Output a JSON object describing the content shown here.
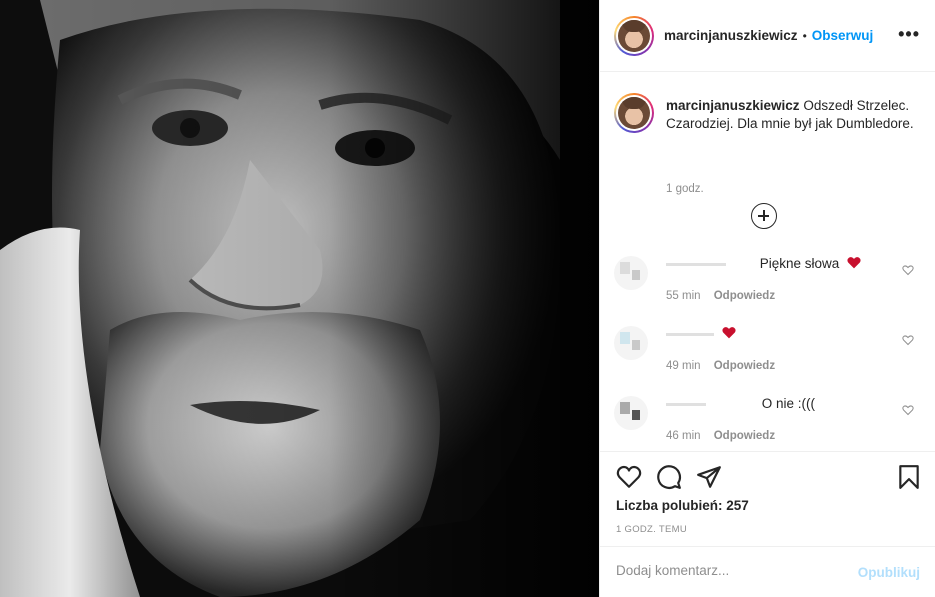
{
  "header": {
    "username": "marcinjanuszkiewicz",
    "separator": "•",
    "follow_label": "Obserwuj",
    "more_icon": "more-options-icon",
    "more_glyph": "•••"
  },
  "caption": {
    "username": "marcinjanuszkiewicz",
    "text": "Odszedł Strzelec. Czarodziej. Dla mnie był jak Dumbledore.",
    "time": "1 godz."
  },
  "load_more_icon": "plus-circle-icon",
  "comments": [
    {
      "text": "Piękne słowa",
      "emoji": "red-heart",
      "time": "55 min",
      "reply_label": "Odpowiedz"
    },
    {
      "text": "",
      "emoji": "red-heart",
      "time": "49 min",
      "reply_label": "Odpowiedz"
    },
    {
      "text": "O nie :(((",
      "emoji": "",
      "time": "46 min",
      "reply_label": "Odpowiedz"
    }
  ],
  "actions": {
    "icons": [
      "heart-icon",
      "comment-icon",
      "share-icon",
      "bookmark-icon"
    ],
    "likes": "Liczba polubień: 257",
    "post_time": "1 GODZ. TEMU"
  },
  "add_comment": {
    "placeholder": "Dodaj komentarz...",
    "publish_label": "Opublikuj"
  },
  "colors": {
    "link": "#0095f6",
    "publish_disabled": "#b2dffc",
    "muted": "#8e8e8e",
    "heart": "#ed4956"
  }
}
